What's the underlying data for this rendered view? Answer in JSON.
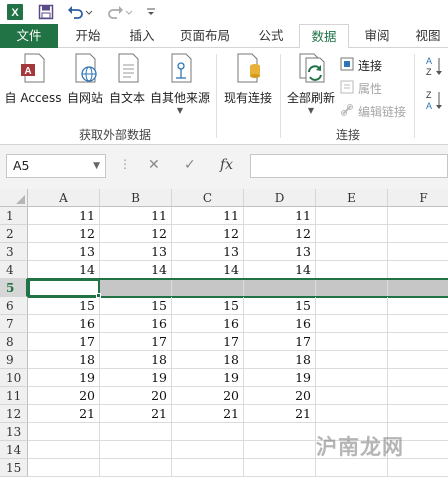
{
  "quick_access": {
    "app_icon": "excel-icon",
    "items": [
      "save-icon",
      "undo-icon",
      "redo-icon",
      "customize-icon"
    ]
  },
  "tabs": [
    {
      "label": "文件",
      "kind": "file"
    },
    {
      "label": "开始"
    },
    {
      "label": "插入"
    },
    {
      "label": "页面布局"
    },
    {
      "label": "公式"
    },
    {
      "label": "数据",
      "kind": "active"
    },
    {
      "label": "审阅"
    },
    {
      "label": "视图"
    }
  ],
  "ribbon": {
    "external": {
      "buttons": [
        "自 Access",
        "自网站",
        "自文本",
        "自其他来源"
      ],
      "group_label": "获取外部数据"
    },
    "existing_connections": "现有连接",
    "connections": {
      "refresh_all": "全部刷新",
      "connect": "连接",
      "properties": "属性",
      "edit_links": "编辑链接",
      "group_label": "连接"
    },
    "sort": {
      "az": "A↓Z",
      "za": "Z↓A"
    }
  },
  "formula_bar": {
    "name_box": "A5",
    "cancel_symbol": "✕",
    "enter_symbol": "✓",
    "fx_symbol": "fx",
    "value": ""
  },
  "grid": {
    "columns": [
      "A",
      "B",
      "C",
      "D",
      "E",
      "F"
    ],
    "selected_row": 5,
    "active_cell": "A5",
    "rows": [
      {
        "n": "1",
        "cells": [
          "11",
          "11",
          "11",
          "11"
        ]
      },
      {
        "n": "2",
        "cells": [
          "12",
          "12",
          "12",
          "12"
        ]
      },
      {
        "n": "3",
        "cells": [
          "13",
          "13",
          "13",
          "13"
        ]
      },
      {
        "n": "4",
        "cells": [
          "14",
          "14",
          "14",
          "14"
        ]
      },
      {
        "n": "5",
        "cells": [
          "",
          "",
          "",
          ""
        ]
      },
      {
        "n": "6",
        "cells": [
          "15",
          "15",
          "15",
          "15"
        ]
      },
      {
        "n": "7",
        "cells": [
          "16",
          "16",
          "16",
          "16"
        ]
      },
      {
        "n": "8",
        "cells": [
          "17",
          "17",
          "17",
          "17"
        ]
      },
      {
        "n": "9",
        "cells": [
          "18",
          "18",
          "18",
          "18"
        ]
      },
      {
        "n": "10",
        "cells": [
          "19",
          "19",
          "19",
          "19"
        ]
      },
      {
        "n": "11",
        "cells": [
          "20",
          "20",
          "20",
          "20"
        ]
      },
      {
        "n": "12",
        "cells": [
          "21",
          "21",
          "21",
          "21"
        ]
      },
      {
        "n": "13",
        "cells": [
          "",
          "",
          "",
          ""
        ]
      },
      {
        "n": "14",
        "cells": [
          "",
          "",
          "",
          ""
        ]
      },
      {
        "n": "15",
        "cells": [
          "",
          "",
          "",
          ""
        ]
      }
    ]
  },
  "watermark": "沪南龙网",
  "colors": {
    "accent": "#217346",
    "row_selection": "#c6c6c6"
  }
}
